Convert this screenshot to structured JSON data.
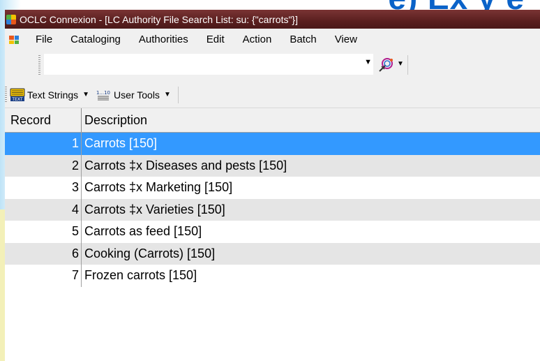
{
  "window": {
    "title": "OCLC Connexion - [LC Authority File Search List: su: {\"carrots\"}]",
    "title_bar_color": "#5a1f1f"
  },
  "slide": {
    "banner_fragment": "e) Ex y e"
  },
  "menu": {
    "items": [
      "File",
      "Cataloging",
      "Authorities",
      "Edit",
      "Action",
      "Batch",
      "View"
    ]
  },
  "toolbar": {
    "combo_value": "",
    "tool_icon": "macro-network-icon"
  },
  "toolbar2": {
    "text_strings_label": "Text Strings",
    "user_tools_label": "User Tools",
    "text_icon_caption": "TEXT",
    "user_tools_icon_caption": "1...10"
  },
  "grid": {
    "headers": {
      "record": "Record",
      "description": "Description"
    },
    "selected_color": "#3399ff",
    "rows": [
      {
        "record": "1",
        "description": "Carrots [150]",
        "selected": true
      },
      {
        "record": "2",
        "description": "Carrots ‡x Diseases and pests [150]"
      },
      {
        "record": "3",
        "description": "Carrots ‡x Marketing [150]"
      },
      {
        "record": "4",
        "description": "Carrots ‡x Varieties [150]"
      },
      {
        "record": "5",
        "description": "Carrots as feed [150]"
      },
      {
        "record": "6",
        "description": "Cooking (Carrots) [150]"
      },
      {
        "record": "7",
        "description": "Frozen carrots [150]"
      }
    ]
  }
}
